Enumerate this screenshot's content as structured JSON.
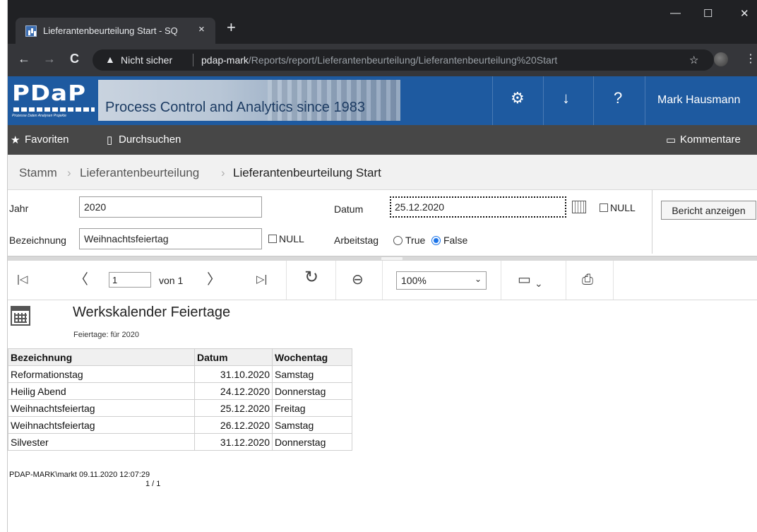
{
  "browser": {
    "tab_title": "Lieferantenbeurteilung Start - SQ",
    "tab_close": "×",
    "new_tab": "+",
    "minimize": "—",
    "maximize": "☐",
    "close": "✕",
    "back": "←",
    "forward": "→",
    "reload": "C",
    "warning": "▲",
    "not_secure": "Nicht sicher",
    "url_host": "pdap-mark",
    "url_path": "/Reports/report/Lieferantenbeurteilung/Lieferantenbeurteilung%20Start",
    "star": "☆",
    "menu": "⋮"
  },
  "app_header": {
    "logo_text": "PDaP",
    "logo_subtitle": "Prozesse Daten Analysen Projekte",
    "banner_text": "Process Control and Analytics since 1983",
    "settings_icon": "⚙",
    "download_icon": "↓",
    "help_icon": "?",
    "user_name": "Mark Hausmann"
  },
  "menubar": {
    "favorites_icon": "★",
    "favorites_label": "Favoriten",
    "browse_icon": "▯",
    "browse_label": "Durchsuchen",
    "comments_icon": "▭",
    "comments_label": "Kommentare"
  },
  "breadcrumb": {
    "items": [
      "Stamm",
      "Lieferantenbeurteilung",
      "Lieferantenbeurteilung Start"
    ],
    "separator": "›"
  },
  "params": {
    "jahr_label": "Jahr",
    "jahr_value": "2020",
    "bezeichnung_label": "Bezeichnung",
    "bezeichnung_value": "Weihnachtsfeiertag",
    "bezeichnung_null": "NULL",
    "datum_label": "Datum",
    "datum_value": "25.12.2020",
    "datum_null": "NULL",
    "arbeitstag_label": "Arbeitstag",
    "arbeitstag_true": "True",
    "arbeitstag_false": "False",
    "arbeitstag_selected": "False",
    "report_button": "Bericht anzeigen"
  },
  "report_toolbar": {
    "first_icon": "|◁",
    "prev_icon": "〈",
    "page_value": "1",
    "page_of": "von 1",
    "next_icon": "〉",
    "last_icon": "▷|",
    "refresh_icon": "↻",
    "back_icon": "⊖",
    "zoom_value": "100%",
    "zoom_caret": "⌄",
    "save_icon": "▭",
    "save_caret": "⌄",
    "print_icon": "⎙"
  },
  "report": {
    "title": "Werkskalender Feiertage",
    "subtitle": "Feiertage: für 2020",
    "columns": [
      "Bezeichnung",
      "Datum",
      "Wochentag"
    ],
    "rows": [
      [
        "Reformationstag",
        "31.10.2020",
        "Samstag"
      ],
      [
        "Heilig Abend",
        "24.12.2020",
        "Donnerstag"
      ],
      [
        "Weihnachtsfeiertag",
        "25.12.2020",
        "Freitag"
      ],
      [
        "Weihnachtsfeiertag",
        "26.12.2020",
        "Samstag"
      ],
      [
        "Silvester",
        "31.12.2020",
        "Donnerstag"
      ]
    ],
    "footer_user": "PDAP-MARK\\markt 09.11.2020 12:07:29",
    "footer_page": "1 / 1"
  }
}
